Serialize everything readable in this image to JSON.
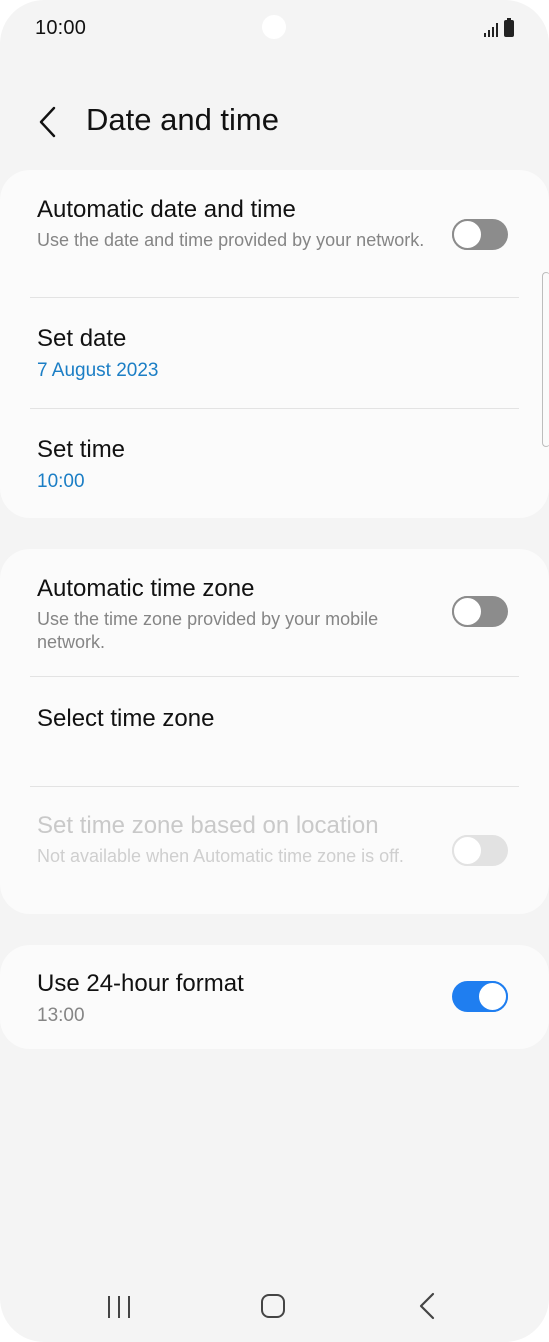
{
  "status_bar": {
    "time": "10:00"
  },
  "header": {
    "title": "Date and time"
  },
  "section1": {
    "auto_date": {
      "title": "Automatic date and time",
      "subtitle": "Use the date and time provided by your network.",
      "toggle": "off"
    },
    "set_date": {
      "title": "Set date",
      "value": "7 August 2023"
    },
    "set_time": {
      "title": "Set time",
      "value": "10:00"
    }
  },
  "section2": {
    "auto_zone": {
      "title": "Automatic time zone",
      "subtitle": "Use the time zone provided by your mobile network.",
      "toggle": "off"
    },
    "select_zone": {
      "title": "Select time zone"
    },
    "zone_location": {
      "title": "Set time zone based on location",
      "subtitle": "Not available when Automatic time zone is off.",
      "toggle": "off-disabled"
    }
  },
  "section3": {
    "format24": {
      "title": "Use 24-hour format",
      "value": "13:00",
      "toggle": "on"
    }
  },
  "colors": {
    "accent": "#1f7ef0",
    "link": "#1b7ec5",
    "background": "#f4f4f4",
    "card": "#fbfbfb"
  },
  "icons": {
    "back": "chevron-left-icon",
    "nav_recents": "recents-icon",
    "nav_home": "home-icon",
    "nav_back": "back-icon"
  }
}
